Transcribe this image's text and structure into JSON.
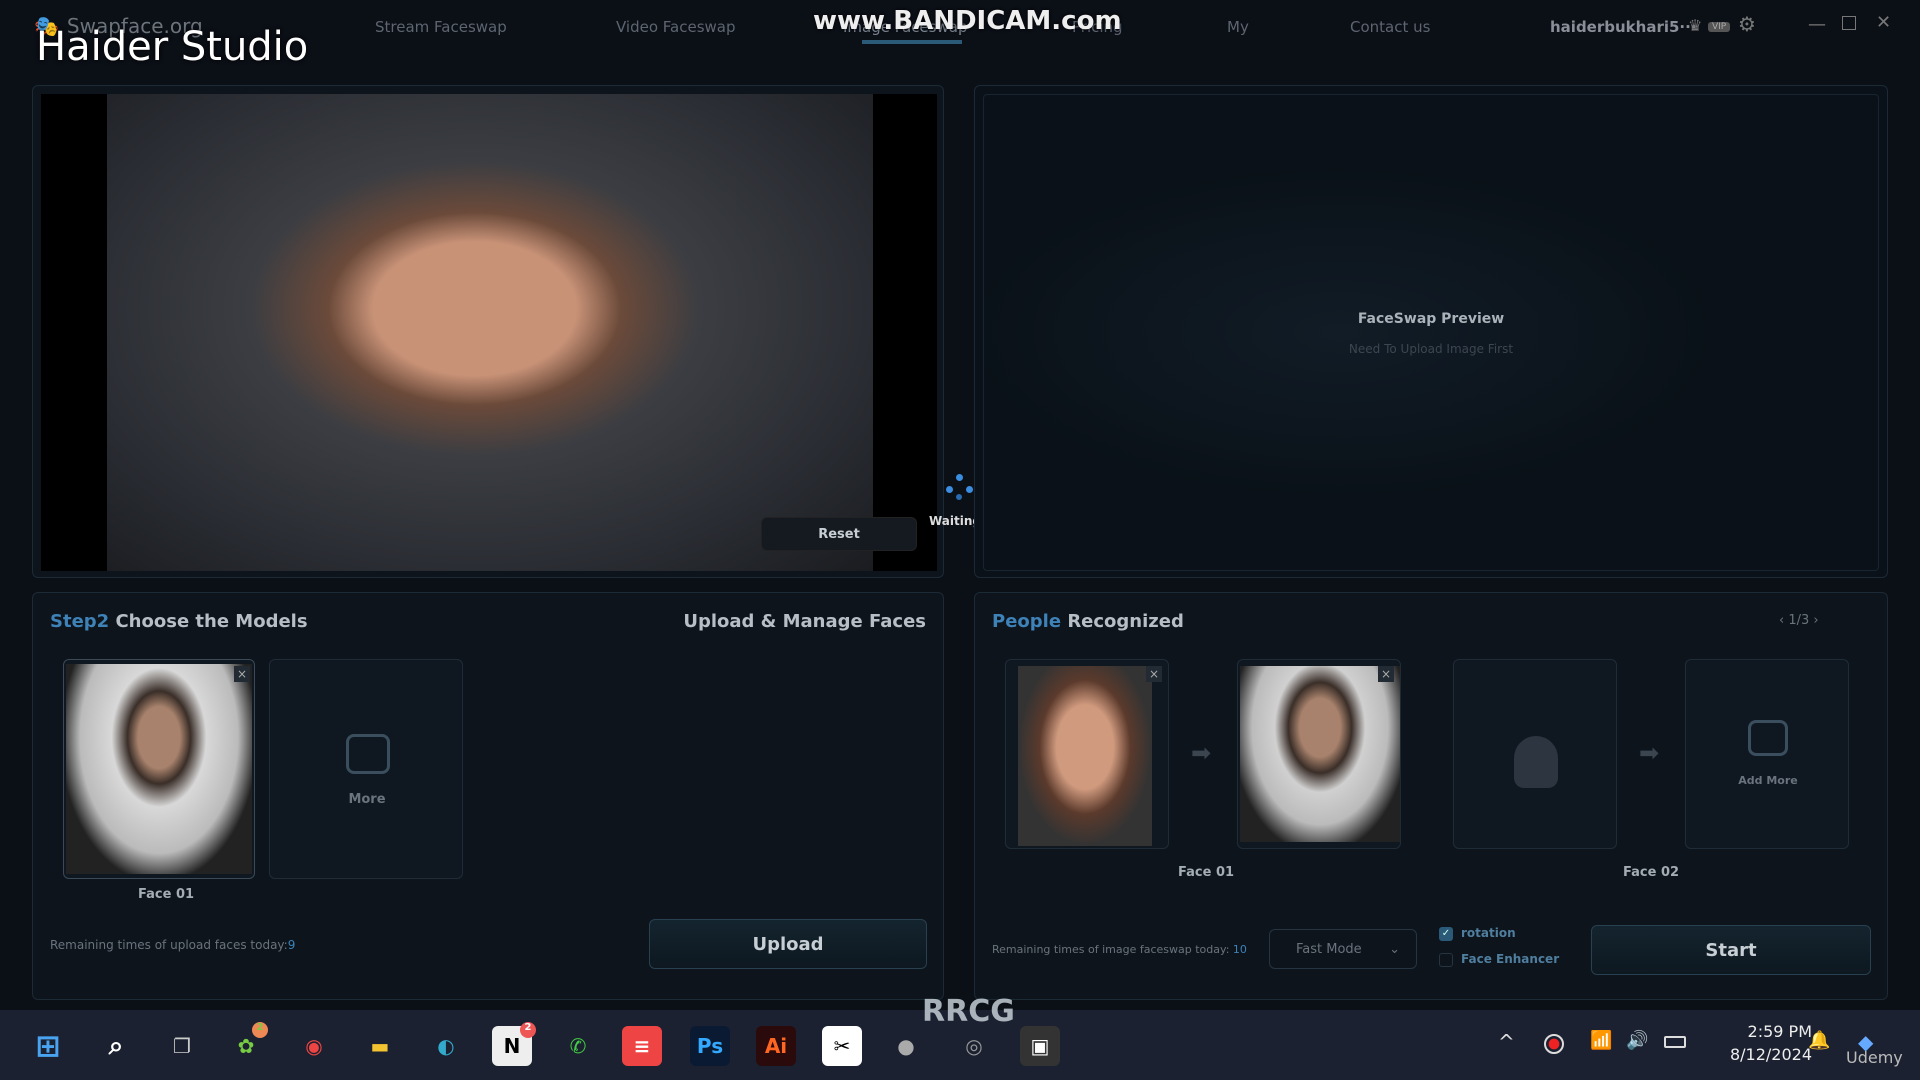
{
  "watermark_overlay": "Haider Studio",
  "bandicam": "www.BANDICAM.com",
  "app": {
    "logo": "Swapface.org",
    "nav": [
      "Stream Faceswap",
      "Video Faceswap",
      "Image Faceswap",
      "Pricing",
      "My",
      "Contact us"
    ],
    "active_nav": "Image Faceswap",
    "user": "haiderbukhari5···",
    "vip": "VIP"
  },
  "source": {
    "reset": "Reset"
  },
  "status": {
    "waiting": "Waiting..."
  },
  "preview": {
    "title": "FaceSwap Preview",
    "subtitle": "Need To Upload Image First"
  },
  "models": {
    "title_hl": "Step2",
    "title": "Choose the Models",
    "manage": "Upload & Manage Faces",
    "faces": [
      {
        "label": "Face 01"
      }
    ],
    "more": "More",
    "remaining_label": "Remaining times of upload faces today:",
    "remaining_value": "9",
    "upload": "Upload"
  },
  "people": {
    "title_hl": "People",
    "title": "Recognized",
    "pager": "1/3",
    "pairs": [
      {
        "label": "Face 01"
      },
      {
        "label": "Face 02"
      }
    ],
    "add_more": "Add More",
    "remaining_label": "Remaining times of image faceswap today:",
    "remaining_value": "10",
    "mode": "Fast Mode",
    "rotation": "rotation",
    "rotation_checked": true,
    "enhancer": "Face Enhancer",
    "enhancer_checked": false,
    "start": "Start"
  },
  "taskbar": {
    "time": "2:59 PM",
    "date": "8/12/2024",
    "badges": {
      "app1": "2",
      "notion": "2"
    },
    "ps": "Ps",
    "ai": "Ai",
    "watermark": "RRCG",
    "udemy": "Udemy"
  },
  "colors": {
    "accent": "#3e82b8",
    "bg": "#0b0f16"
  }
}
